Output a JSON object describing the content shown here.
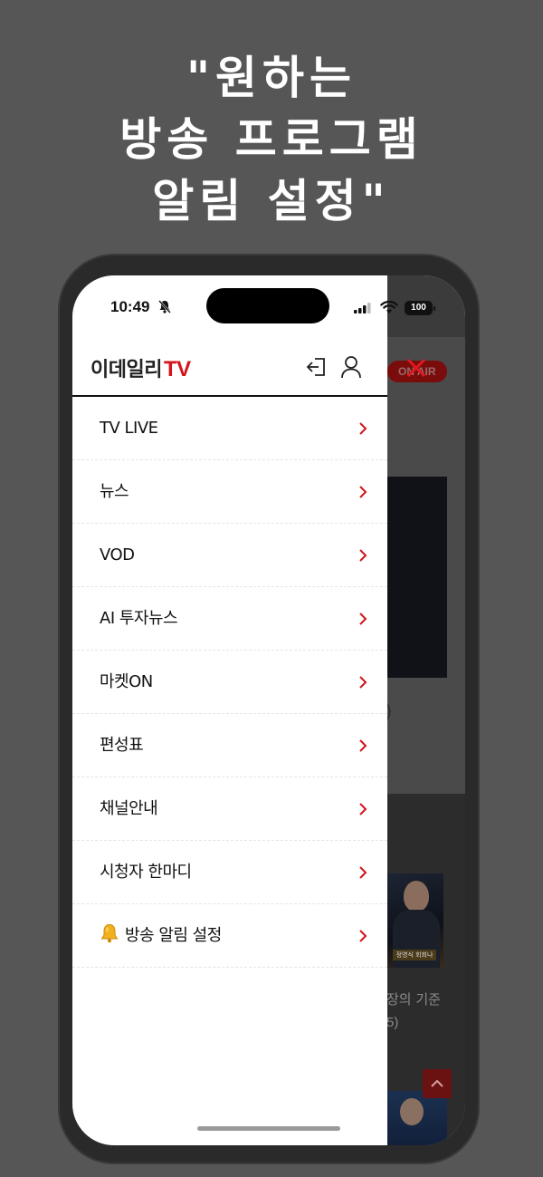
{
  "promo": {
    "line1": "\"원하는",
    "line2": "방송 프로그램",
    "line3": "알림 설정\""
  },
  "status_bar": {
    "time": "10:49",
    "battery": "100"
  },
  "drawer": {
    "logo_text": "이데일리",
    "logo_tv": "TV",
    "menu_items": [
      {
        "label": "TV LIVE"
      },
      {
        "label": "뉴스"
      },
      {
        "label": "VOD"
      },
      {
        "label": "AI 투자뉴스"
      },
      {
        "label": "마켓ON"
      },
      {
        "label": "편성표"
      },
      {
        "label": "채널안내"
      },
      {
        "label": "시청자 한마디"
      },
      {
        "label": "방송 알림 설정"
      }
    ]
  },
  "background": {
    "onair_badge": "ON AIR",
    "paren": ")",
    "thumb_label": "정영식 회회나",
    "caption_line1": "장의 기준",
    "caption_line2": "5)"
  },
  "colors": {
    "brand_red": "#d2141b",
    "page_bg": "#565656",
    "chevron_red": "#d2141b"
  },
  "icons": {
    "login": "login-icon",
    "user": "user-icon",
    "close": "close-icon",
    "chevron": "chevron-right-icon",
    "bell": "bell-icon"
  }
}
